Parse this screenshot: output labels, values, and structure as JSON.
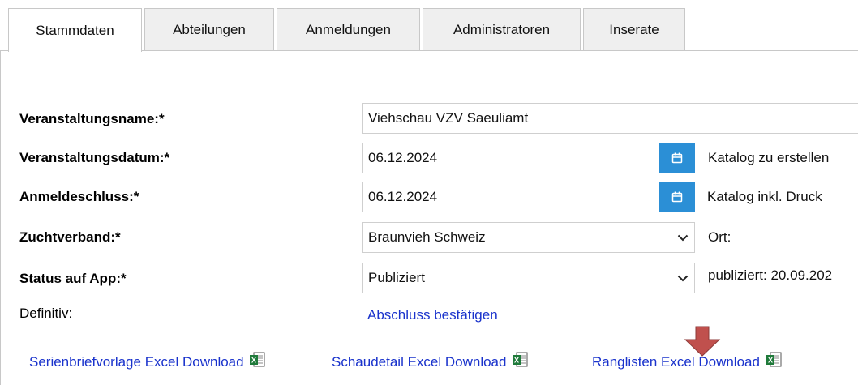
{
  "tabs": [
    {
      "label": "Stammdaten",
      "active": true
    },
    {
      "label": "Abteilungen"
    },
    {
      "label": "Anmeldungen"
    },
    {
      "label": "Administratoren"
    },
    {
      "label": "Inserate"
    }
  ],
  "form": {
    "veranstaltungsname": {
      "label": "Veranstaltungsname:*",
      "value": "Viehschau VZV Saeuliamt"
    },
    "veranstaltungsdatum": {
      "label": "Veranstaltungsdatum:*",
      "value": "06.12.2024",
      "side_label": "Katalog zu erstellen"
    },
    "anmeldeschluss": {
      "label": "Anmeldeschluss:*",
      "value": "06.12.2024",
      "side_value": "Katalog inkl. Druck"
    },
    "zuchtverband": {
      "label": "Zuchtverband:*",
      "value": "Braunvieh Schweiz",
      "side_label": "Ort:"
    },
    "status": {
      "label": "Status auf App:*",
      "value": "Publiziert",
      "side_label": "publiziert: 20.09.202"
    },
    "definitiv": {
      "label": "Definitiv:",
      "link": "Abschluss bestätigen"
    }
  },
  "downloads": [
    {
      "label": "Serienbriefvorlage Excel Download",
      "icon": "excel-icon"
    },
    {
      "label": "Schaudetail Excel Download",
      "icon": "excel-icon"
    },
    {
      "label": "Ranglisten Excel Download",
      "icon": "excel-icon"
    }
  ],
  "colors": {
    "accent": "#2b8fd6",
    "link": "#1a33cc",
    "arrow": "#c0504d"
  }
}
